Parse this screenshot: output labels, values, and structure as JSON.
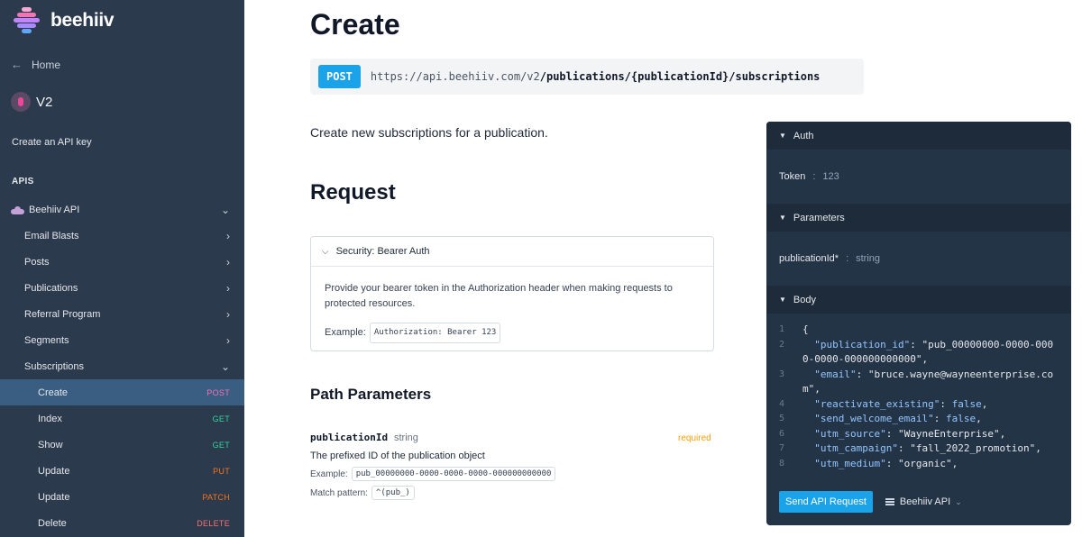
{
  "brand": {
    "name": "beehiiv",
    "colors": [
      "#f9a8d4",
      "#f472b6",
      "#c084fc",
      "#a78bfa",
      "#60a5fa"
    ]
  },
  "sidebar": {
    "home_label": "Home",
    "version_label": "V2",
    "api_key_label": "Create an API key",
    "apis_heading": "APIS",
    "group_label": "Beehiiv API",
    "items": [
      {
        "label": "Email Blasts"
      },
      {
        "label": "Posts"
      },
      {
        "label": "Publications"
      },
      {
        "label": "Referral Program"
      },
      {
        "label": "Segments"
      },
      {
        "label": "Subscriptions"
      }
    ],
    "sub_items": [
      {
        "label": "Create",
        "method": "POST",
        "color": "#f472b6"
      },
      {
        "label": "Index",
        "method": "GET",
        "color": "#34d399"
      },
      {
        "label": "Show",
        "method": "GET",
        "color": "#34d399"
      },
      {
        "label": "Update",
        "method": "PUT",
        "color": "#f97316"
      },
      {
        "label": "Update",
        "method": "PATCH",
        "color": "#f97316"
      },
      {
        "label": "Delete",
        "method": "DELETE",
        "color": "#f87171"
      }
    ]
  },
  "main": {
    "title": "Create",
    "endpoint": {
      "method": "POST",
      "base": "https://api.beehiiv.com/v2",
      "path": "/publications/{publicationId}/subscriptions"
    },
    "description": "Create new subscriptions for a publication.",
    "request_heading": "Request",
    "security": {
      "title": "Security: Bearer Auth",
      "text": "Provide your bearer token in the Authorization header when making requests to protected resources.",
      "example_label": "Example:",
      "example_value": "Authorization: Bearer 123"
    },
    "path_params_heading": "Path Parameters",
    "param": {
      "name": "publicationId",
      "type": "string",
      "required": "required",
      "description": "The prefixed ID of the publication object",
      "example_label": "Example:",
      "example_value": "pub_00000000-0000-0000-0000-000000000000",
      "pattern_label": "Match pattern:",
      "pattern_value": "^(pub_)"
    }
  },
  "console": {
    "auth_heading": "Auth",
    "token_label": "Token",
    "token_sep": ":",
    "token_value": "123",
    "params_heading": "Parameters",
    "param_label": "publicationId*",
    "param_sep": ":",
    "param_value": "string",
    "body_heading": "Body",
    "send_label": "Send API Request",
    "server_label": "Beehiiv API",
    "code_lines": [
      {
        "n": "1",
        "text": "{"
      },
      {
        "n": "2",
        "text": "  \"publication_id\": \"pub_00000000-0000-000"
      },
      {
        "n": "",
        "text": "0-0000-000000000000\","
      },
      {
        "n": "3",
        "text": "  \"email\": \"bruce.wayne@wayneenterprise.co"
      },
      {
        "n": "",
        "text": "m\","
      },
      {
        "n": "4",
        "text": "  \"reactivate_existing\": false,"
      },
      {
        "n": "5",
        "text": "  \"send_welcome_email\": false,"
      },
      {
        "n": "6",
        "text": "  \"utm_source\": \"WayneEnterprise\","
      },
      {
        "n": "7",
        "text": "  \"utm_campaign\": \"fall_2022_promotion\","
      },
      {
        "n": "8",
        "text": "  \"utm_medium\": \"organic\","
      }
    ]
  }
}
